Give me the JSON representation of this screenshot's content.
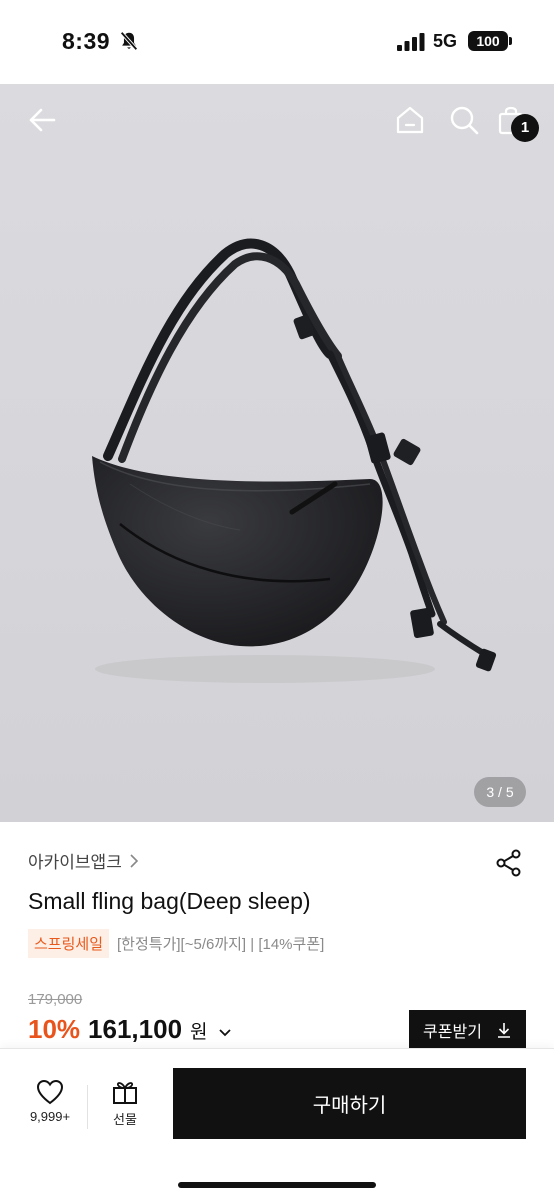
{
  "status_bar": {
    "time": "8:39",
    "network": "5G",
    "battery": "100"
  },
  "header": {
    "cart_count": "1"
  },
  "gallery": {
    "indicator": "3 / 5"
  },
  "product": {
    "brand": "아카이브앱크",
    "title": "Small fling bag(Deep sleep)",
    "sale_badge": "스프링세일",
    "tag_text": "[한정특가][~5/6까지] | [14%쿠폰]",
    "original_price": "179,000",
    "discount": "10%",
    "price": "161,100",
    "currency": "원",
    "coupon_button": "쿠폰받기"
  },
  "bottom_bar": {
    "like_count": "9,999+",
    "gift_label": "선물",
    "buy_label": "구매하기"
  },
  "colors": {
    "accent": "#e8541c",
    "primary": "#111111"
  },
  "icons": [
    "back-arrow-icon",
    "home-icon",
    "search-icon",
    "shopping-bag-icon",
    "share-icon",
    "heart-icon",
    "gift-icon",
    "download-icon",
    "bell-slash-icon"
  ]
}
